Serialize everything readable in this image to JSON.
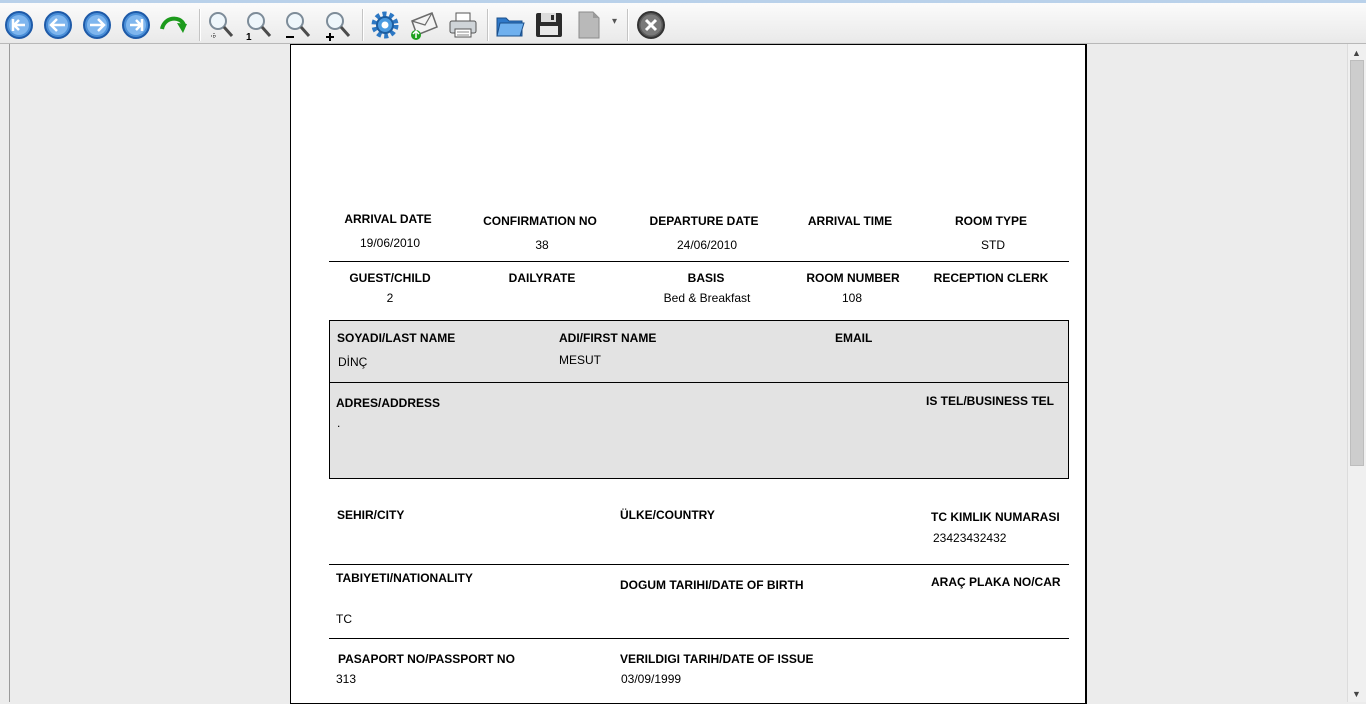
{
  "toolbar": {
    "buttons": [
      {
        "name": "first-page-button",
        "icon": "first-page-icon"
      },
      {
        "name": "previous-page-button",
        "icon": "arrow-left-icon"
      },
      {
        "name": "next-page-button",
        "icon": "arrow-right-icon"
      },
      {
        "name": "last-page-button",
        "icon": "last-page-icon"
      },
      {
        "name": "refresh-button",
        "icon": "green-curved-arrow-icon"
      },
      {
        "name": "zoom-button",
        "icon": "magnifier-icon"
      },
      {
        "name": "zoom-actual-size-button",
        "icon": "magnifier-one-icon"
      },
      {
        "name": "zoom-out-button",
        "icon": "magnifier-minus-icon"
      },
      {
        "name": "zoom-in-button",
        "icon": "magnifier-plus-icon"
      },
      {
        "name": "settings-button",
        "icon": "gear-icon"
      },
      {
        "name": "send-email-button",
        "icon": "envelope-icon"
      },
      {
        "name": "print-button",
        "icon": "printer-icon"
      },
      {
        "name": "open-button",
        "icon": "folder-icon"
      },
      {
        "name": "save-button",
        "icon": "floppy-disk-icon"
      },
      {
        "name": "export-button",
        "icon": "export-document-icon"
      },
      {
        "name": "close-button",
        "icon": "close-icon"
      }
    ],
    "export_dropdown_glyph": "▾"
  },
  "scrollbar": {
    "up_glyph": "▲",
    "down_glyph": "▼"
  },
  "report": {
    "arrival_date_label": "ARRIVAL DATE",
    "arrival_date": "19/06/2010",
    "confirmation_no_label": "CONFIRMATION NO",
    "confirmation_no": "38",
    "departure_date_label": "DEPARTURE DATE",
    "departure_date": "24/06/2010",
    "arrival_time_label": "ARRIVAL TIME",
    "room_type_label": "ROOM TYPE",
    "room_type": "STD",
    "guest_child_label": "GUEST/CHILD",
    "guest_child": "2",
    "daily_rate_label": "DAILYRATE",
    "basis_label": "BASIS",
    "basis": "Bed & Breakfast",
    "room_number_label": "ROOM NUMBER",
    "room_number": "108",
    "reception_clerk_label": "RECEPTION CLERK",
    "last_name_label": "SOYADI/LAST NAME",
    "last_name": "DİNÇ",
    "first_name_label": "ADI/FIRST NAME",
    "first_name": "MESUT",
    "email_label": "EMAIL",
    "address_label": "ADRES/ADDRESS",
    "address": ".",
    "business_tel_label": "IS TEL/BUSINESS TEL",
    "city_label": "SEHIR/CITY",
    "country_label": "ÜLKE/COUNTRY",
    "tc_id_label": "TC KIMLIK NUMARASI",
    "tc_id": "23423432432",
    "nationality_label": "TABIYETI/NATIONALITY",
    "nationality": "TC",
    "birth_date_label": "DOGUM TARIHI/DATE OF BIRTH",
    "car_plate_label": "ARAÇ PLAKA NO/CAR",
    "passport_no_label": "PASAPORT NO/PASSPORT NO",
    "passport_no": "313",
    "issue_date_label": "VERILDIGI TARIH/DATE OF ISSUE",
    "issue_date": "03/09/1999"
  }
}
